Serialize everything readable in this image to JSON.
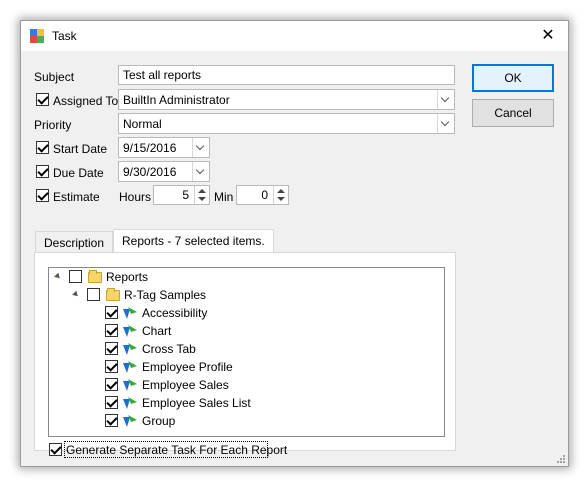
{
  "window": {
    "title": "Task",
    "close_glyph": "✕"
  },
  "fields": {
    "subject_label": "Subject",
    "subject_value": "Test all reports",
    "assigned_label": "Assigned To",
    "assigned_value": "BuiltIn Administrator",
    "priority_label": "Priority",
    "priority_value": "Normal",
    "start_label": "Start Date",
    "start_value": "9/15/2016",
    "due_label": "Due Date",
    "due_value": "9/30/2016",
    "estimate_label": "Estimate",
    "hours_label": "Hours",
    "hours_value": "5",
    "min_label": "Min",
    "min_value": "0"
  },
  "buttons": {
    "ok": "OK",
    "cancel": "Cancel"
  },
  "tabs": [
    {
      "label": "Description"
    },
    {
      "label": "Reports -  7 selected items."
    }
  ],
  "tree": {
    "root": "Reports",
    "group": "R-Tag Samples",
    "items": [
      {
        "label": "Accessibility"
      },
      {
        "label": "Chart"
      },
      {
        "label": "Cross Tab"
      },
      {
        "label": "Employee  Profile"
      },
      {
        "label": "Employee  Sales"
      },
      {
        "label": "Employee Sales List"
      },
      {
        "label": "Group"
      }
    ]
  },
  "generate_label": "Generate Separate Task For Each Report",
  "icons": {
    "app": "task-app-icon",
    "folder": "folder-icon",
    "report": "report-icon"
  },
  "colors": {
    "accent": "#0078d7",
    "folder": "#f7d56a",
    "report_green": "#2fae3d",
    "report_blue": "#1f6fd1"
  }
}
